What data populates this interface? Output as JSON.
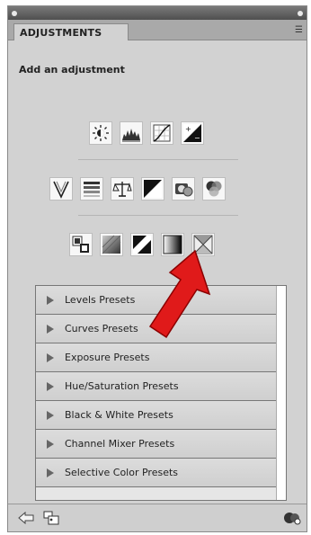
{
  "panel": {
    "tab_label": "ADJUSTMENTS",
    "menu_glyph": "☰",
    "subtitle": "Add an adjustment"
  },
  "icon_rows": [
    [
      "brightness-contrast-icon",
      "levels-icon",
      "curves-icon",
      "exposure-icon"
    ],
    [
      "vibrance-icon",
      "hue-saturation-icon",
      "color-balance-icon",
      "black-white-icon",
      "photo-filter-icon",
      "channel-mixer-icon"
    ],
    [
      "invert-icon",
      "posterize-icon",
      "threshold-icon",
      "gradient-map-icon",
      "selective-color-icon"
    ]
  ],
  "presets": [
    "Levels Presets",
    "Curves Presets",
    "Exposure Presets",
    "Hue/Saturation Presets",
    "Black & White Presets",
    "Channel Mixer Presets",
    "Selective Color Presets"
  ],
  "colors": {
    "panel_bg": "#d2d2d2",
    "arrow_red": "#e01a1a"
  },
  "footer_icons": [
    "return-arrow-icon",
    "clip-layer-icon",
    "visibility-icon"
  ]
}
